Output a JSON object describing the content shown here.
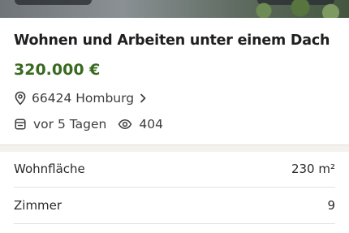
{
  "listing": {
    "title": "Wohnen und Arbeiten unter einem Dach",
    "price": "320.000 €",
    "location": "66424 Homburg",
    "posted": "vor 5 Tagen",
    "views": "404"
  },
  "details": [
    {
      "label": "Wohnfläche",
      "value": "230 m²"
    },
    {
      "label": "Zimmer",
      "value": "9"
    }
  ],
  "colors": {
    "price": "#386a20",
    "text": "#1f1f1f",
    "divider": "#f4f2ee"
  },
  "icons": {
    "location": "location-pin-icon",
    "location_link": "chevron-right-icon",
    "posted": "calendar-icon",
    "views": "eye-icon"
  }
}
